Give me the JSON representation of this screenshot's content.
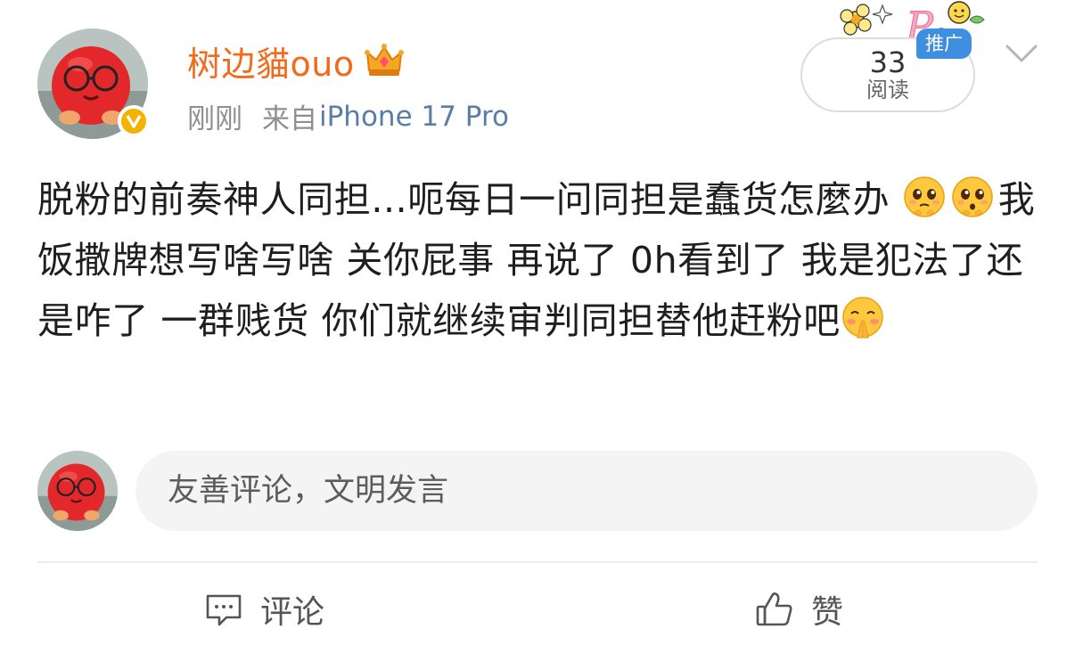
{
  "post": {
    "author": {
      "name": "树边貓ouo",
      "verified": true,
      "crown_icon": "crown-vip-icon"
    },
    "time": "刚刚",
    "source_prefix": "来自",
    "device": "iPhone 17 Pro",
    "read_count": "33",
    "read_label": "阅读",
    "promo_tag": "推广",
    "text_segments": [
      {
        "type": "text",
        "value": "脱粉的前奏神人同担...呃每日一问同担是蠢货怎麼办"
      },
      {
        "type": "emoji",
        "name": "pleading-face-emoji"
      },
      {
        "type": "emoji",
        "name": "pleading-face-emoji"
      },
      {
        "type": "text",
        "value": "我饭撒牌想写啥写啥 关你屁事 再说了 0h看到了 我是犯法了还是咋了 一群贱货 你们就继续审判同担替他赶粉吧"
      },
      {
        "type": "emoji",
        "name": "blushing-hands-together-emoji"
      }
    ]
  },
  "comment_box": {
    "placeholder": "友善评论，文明发言"
  },
  "actions": {
    "comment_label": "评论",
    "like_label": "赞"
  },
  "colors": {
    "username": "#f26a1b",
    "device_link": "#5a7da8",
    "verified_badge": "#f5b300",
    "promo_tag": "#3f8fe0"
  }
}
